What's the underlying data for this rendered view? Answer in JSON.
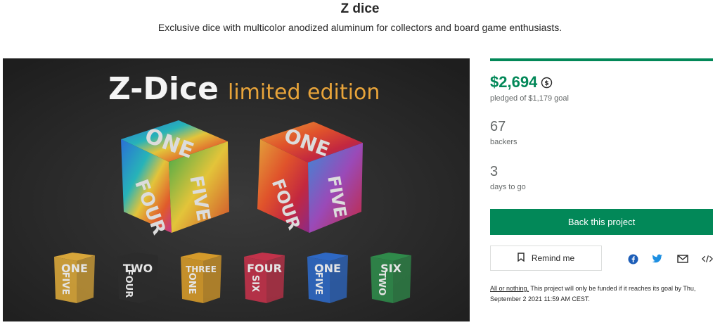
{
  "project": {
    "title": "Z dice",
    "subtitle": "Exclusive dice with multicolor anodized aluminum for collectors and board game enthusiasts."
  },
  "hero": {
    "heading_main": "Z-Dice",
    "heading_accent": "limited edition",
    "big_dice": [
      "ONE",
      "FOUR",
      "FIVE"
    ],
    "small_dice": [
      {
        "top": "ONE",
        "front": "FIVE",
        "color": "#d8a63a"
      },
      {
        "top": "TWO",
        "front": "FOUR",
        "color": "#2c2c2c"
      },
      {
        "top": "THREE",
        "front": "ONE",
        "color": "#d59a2a"
      },
      {
        "top": "FOUR",
        "front": "SIX",
        "color": "#c2324a"
      },
      {
        "top": "ONE",
        "front": "FIVE",
        "color": "#2e68c4"
      },
      {
        "top": "SIX",
        "front": "TWO",
        "color": "#2f8a4a"
      }
    ]
  },
  "campaign": {
    "progress_fraction": 1.0,
    "pledged": "$2,694",
    "pledged_label": "pledged of $1,179 goal",
    "backers_count": "67",
    "backers_label": "backers",
    "days_count": "3",
    "days_label": "days to go",
    "back_button": "Back this project",
    "remind_button": "Remind me",
    "aon_link": "All or nothing.",
    "aon_text": " This project will only be funded if it reaches its goal by Thu, September 2 2021 11:59 AM CEST."
  },
  "colors": {
    "accent": "#028858",
    "muted": "#656969"
  },
  "icons": {
    "currency": "currency-conversion-icon",
    "bookmark": "bookmark-icon",
    "facebook": "facebook-icon",
    "twitter": "twitter-icon",
    "email": "email-icon",
    "embed": "embed-code-icon"
  }
}
